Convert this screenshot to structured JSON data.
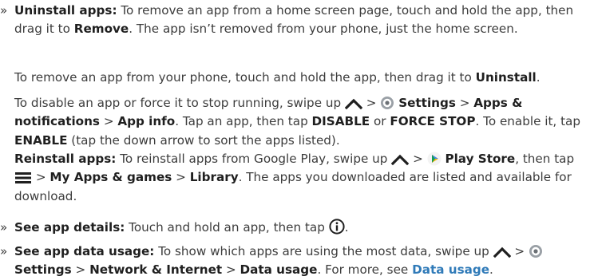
{
  "p1": {
    "bullet": "»",
    "label": "Uninstall apps:",
    "t1": "To remove an app from a home screen page, touch and hold the app, then drag it to",
    "b1": "Remove",
    "t2": ". The app isn’t removed from your phone, just the home screen."
  },
  "p2": {
    "t1": "To remove an app from your phone, touch and hold the app, then drag it to",
    "b1": "Uninstall",
    "t2": "."
  },
  "p3": {
    "t1": "To disable an app or force it to stop running, swipe up",
    "sep1": ">",
    "b1": "Settings",
    "sep2": ">",
    "b2": "Apps & notifications",
    "sep3": ">",
    "b3": "App info",
    "t2": ". Tap an app, then tap",
    "b4": "DISABLE",
    "or": "or",
    "b5": "FORCE STOP",
    "t3": ". To enable it, tap",
    "b6": "ENABLE",
    "t4": "(tap the down arrow to sort the apps listed)."
  },
  "p4": {
    "label": "Reinstall apps:",
    "t1": "To reinstall apps from Google Play, swipe up",
    "sep1": ">",
    "b1": "Play Store",
    "t2": ", then tap",
    "sep2": ">",
    "b2": "My Apps & games",
    "sep3": ">",
    "b3": "Library",
    "t3": ". The apps you downloaded are listed and available for download."
  },
  "p5": {
    "bullet": "»",
    "label": "See app details:",
    "t1": "Touch and hold an app, then tap",
    "t2": "."
  },
  "p6": {
    "bullet": "»",
    "label": "See app data usage:",
    "t1": "To show which apps are using the most data, swipe up",
    "sep1": ">",
    "b1": "Settings",
    "sep2": ">",
    "b2": "Network & Internet",
    "sep3": ">",
    "b3": "Data usage",
    "t2": ". For more, see",
    "link": "Data usage",
    "t3": "."
  },
  "icons": {
    "swipe_up": "chevron-up-icon",
    "settings": "settings-gear-icon",
    "play_store": "play-store-icon",
    "menu": "hamburger-menu-icon",
    "info": "info-icon"
  },
  "colors": {
    "text": "#3c3c3c",
    "bold": "#1f1f1f",
    "link": "#2f7ab8"
  }
}
